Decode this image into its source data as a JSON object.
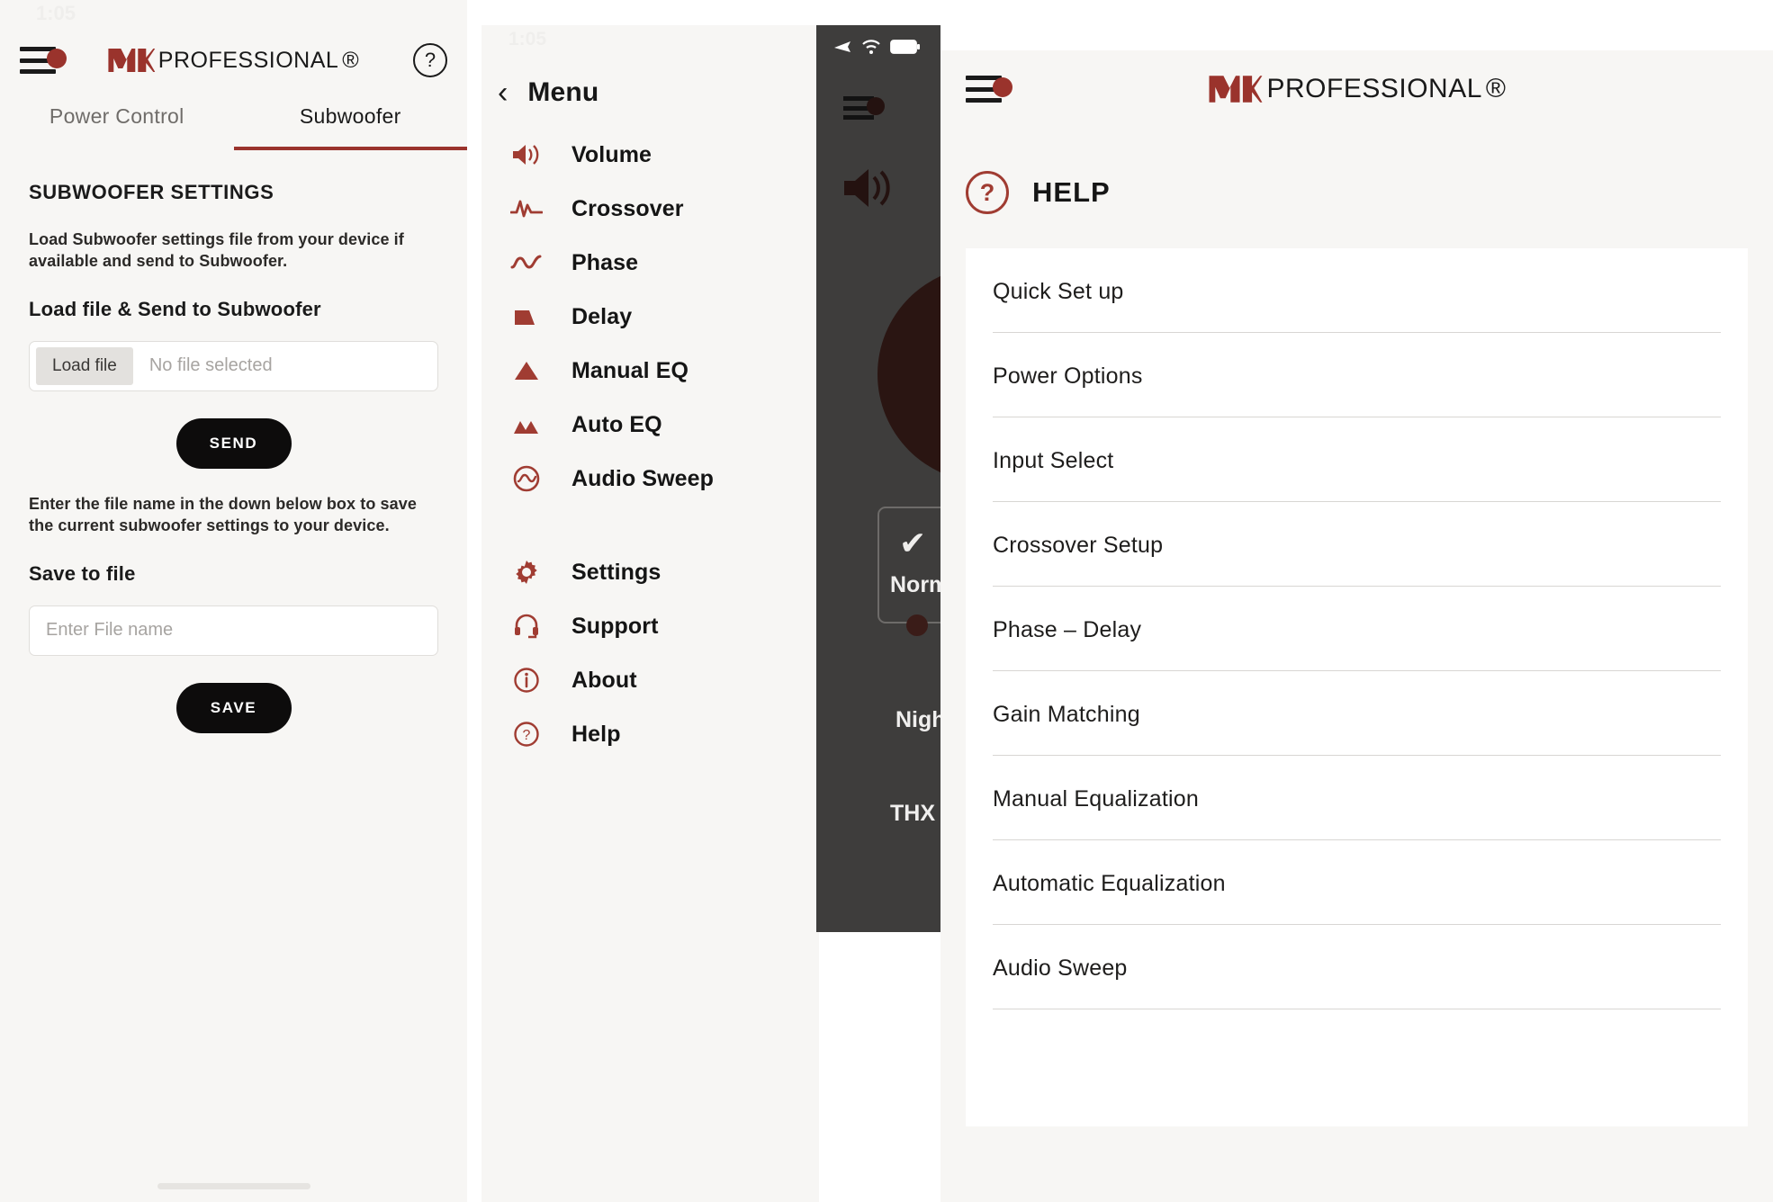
{
  "brand": {
    "name": "MK",
    "word": "PROFESSIONAL",
    "registered": "®",
    "accent": "#a03c32",
    "dark": "#0d0c0c"
  },
  "subwoofer_screen": {
    "status_time": "1:05",
    "help_icon_glyph": "?",
    "tabs": [
      {
        "label": "Power Control",
        "active": false
      },
      {
        "label": "Subwoofer",
        "active": true
      }
    ],
    "section_title": "SUBWOOFER SETTINGS",
    "load_description": "Load Subwoofer settings file from your device if available and send to Subwoofer.",
    "load_label": "Load file & Send to Subwoofer",
    "load_button": "Load file",
    "file_status": "No file selected",
    "send_button": "SEND",
    "save_description": "Enter the file name in the down below box to save the current subwoofer settings to your device.",
    "save_label": "Save to file",
    "filename_placeholder": "Enter File name",
    "filename_value": "",
    "save_button": "SAVE"
  },
  "menu_screen": {
    "status_time": "1:05",
    "back_glyph": "‹",
    "title": "Menu",
    "items": [
      {
        "label": "Volume",
        "icon": "speaker-icon"
      },
      {
        "label": "Crossover",
        "icon": "waveform-icon"
      },
      {
        "label": "Phase",
        "icon": "sine-wave-icon"
      },
      {
        "label": "Delay",
        "icon": "trapezoid-icon"
      },
      {
        "label": "Manual EQ",
        "icon": "triangle-icon"
      },
      {
        "label": "Auto EQ",
        "icon": "double-peak-icon"
      },
      {
        "label": "Audio Sweep",
        "icon": "sweep-circle-icon"
      }
    ],
    "footer_items": [
      {
        "label": "Settings",
        "icon": "gear-icon"
      },
      {
        "label": "Support",
        "icon": "headset-icon"
      },
      {
        "label": "About",
        "icon": "info-icon"
      },
      {
        "label": "Help",
        "icon": "question-icon"
      }
    ]
  },
  "device_screen": {
    "status_icons": [
      "airplane-icon",
      "wifi-icon",
      "battery-icon"
    ],
    "check_glyph": "✔",
    "mode_normal": "Normal",
    "mode_night": "Night",
    "mode_thx": "THX"
  },
  "help_screen": {
    "title": "HELP",
    "help_icon_glyph": "?",
    "topics": [
      "Quick Set up",
      "Power Options",
      "Input Select",
      "Crossover Setup",
      "Phase – Delay",
      "Gain Matching",
      "Manual Equalization",
      "Automatic Equalization",
      "Audio Sweep"
    ]
  }
}
